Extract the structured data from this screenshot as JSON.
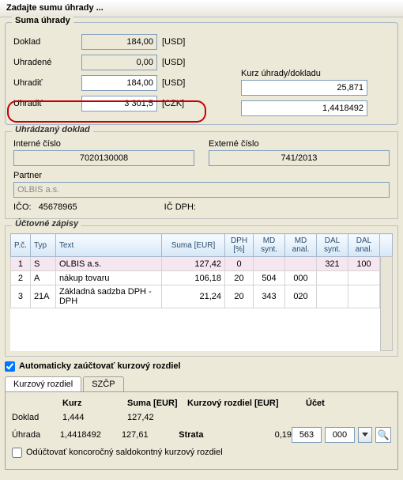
{
  "window": {
    "title": "Zadajte sumu úhrady ..."
  },
  "suma": {
    "legend": "Suma úhrady",
    "doklad_label": "Doklad",
    "doklad_value": "184,00",
    "doklad_unit": "[USD]",
    "uhradene_label": "Uhradené",
    "uhradene_value": "0,00",
    "uhradene_unit": "[USD]",
    "uhradit1_label": "Uhradiť",
    "uhradit1_value": "184,00",
    "uhradit1_unit": "[USD]",
    "uhradit2_label": "Uhradiť",
    "uhradit2_value": "3 301,5",
    "uhradit2_unit": "[CZK]",
    "kurz_label": "Kurz úhrady/dokladu",
    "kurz_value1": "25,871",
    "kurz_value2": "1,4418492"
  },
  "doklad": {
    "legend": "Uhrádzaný doklad",
    "interne_label": "Interné číslo",
    "interne_value": "7020130008",
    "externe_label": "Externé číslo",
    "externe_value": "741/2013",
    "partner_label": "Partner",
    "partner_value": "OLBIS a.s.",
    "ico_label": "IČO:",
    "ico_value": "45678965",
    "icdph_label": "IČ DPH:"
  },
  "zapisy": {
    "legend": "Účtovné zápisy",
    "headers": {
      "pc": "P.č.",
      "typ": "Typ",
      "text": "Text",
      "suma": "Suma [EUR]",
      "dph": "DPH [%]",
      "mds": "MD synt.",
      "mda": "MD anal.",
      "dals": "DAL synt.",
      "dala": "DAL anal."
    },
    "rows": [
      {
        "pc": "1",
        "typ": "S",
        "text": "OLBIS a.s.",
        "suma": "127,42",
        "dph": "0",
        "mds": "",
        "mda": "",
        "dals": "321",
        "dala": "100"
      },
      {
        "pc": "2",
        "typ": "A",
        "text": "nákup tovaru",
        "suma": "106,18",
        "dph": "20",
        "mds": "504",
        "mda": "000",
        "dals": "",
        "dala": ""
      },
      {
        "pc": "3",
        "typ": "21A",
        "text": "Základná sadzba DPH - DPH",
        "suma": "21,24",
        "dph": "20",
        "mds": "343",
        "mda": "020",
        "dals": "",
        "dala": ""
      }
    ]
  },
  "auto_chk": {
    "label": "Automaticky zaúčtovať kurzový rozdiel"
  },
  "tabs": {
    "t1": "Kurzový rozdiel",
    "t2": "SZČP"
  },
  "kr": {
    "h_kurz": "Kurz",
    "h_suma": "Suma",
    "h_eur": "[EUR]",
    "h_kr": "Kurzový rozdiel",
    "h_ucet": "Účet",
    "r1_label": "Doklad",
    "r1_kurz": "1,444",
    "r1_suma": "127,42",
    "r2_label": "Úhrada",
    "r2_kurz": "1,4418492",
    "r2_suma": "127,61",
    "r2_strata": "Strata",
    "r2_kr": "0,19",
    "r2_u1": "563",
    "r2_u2": "000"
  },
  "sub_chk": {
    "label": "Odúčtovať koncoročný saldokontný kurzový rozdiel"
  }
}
